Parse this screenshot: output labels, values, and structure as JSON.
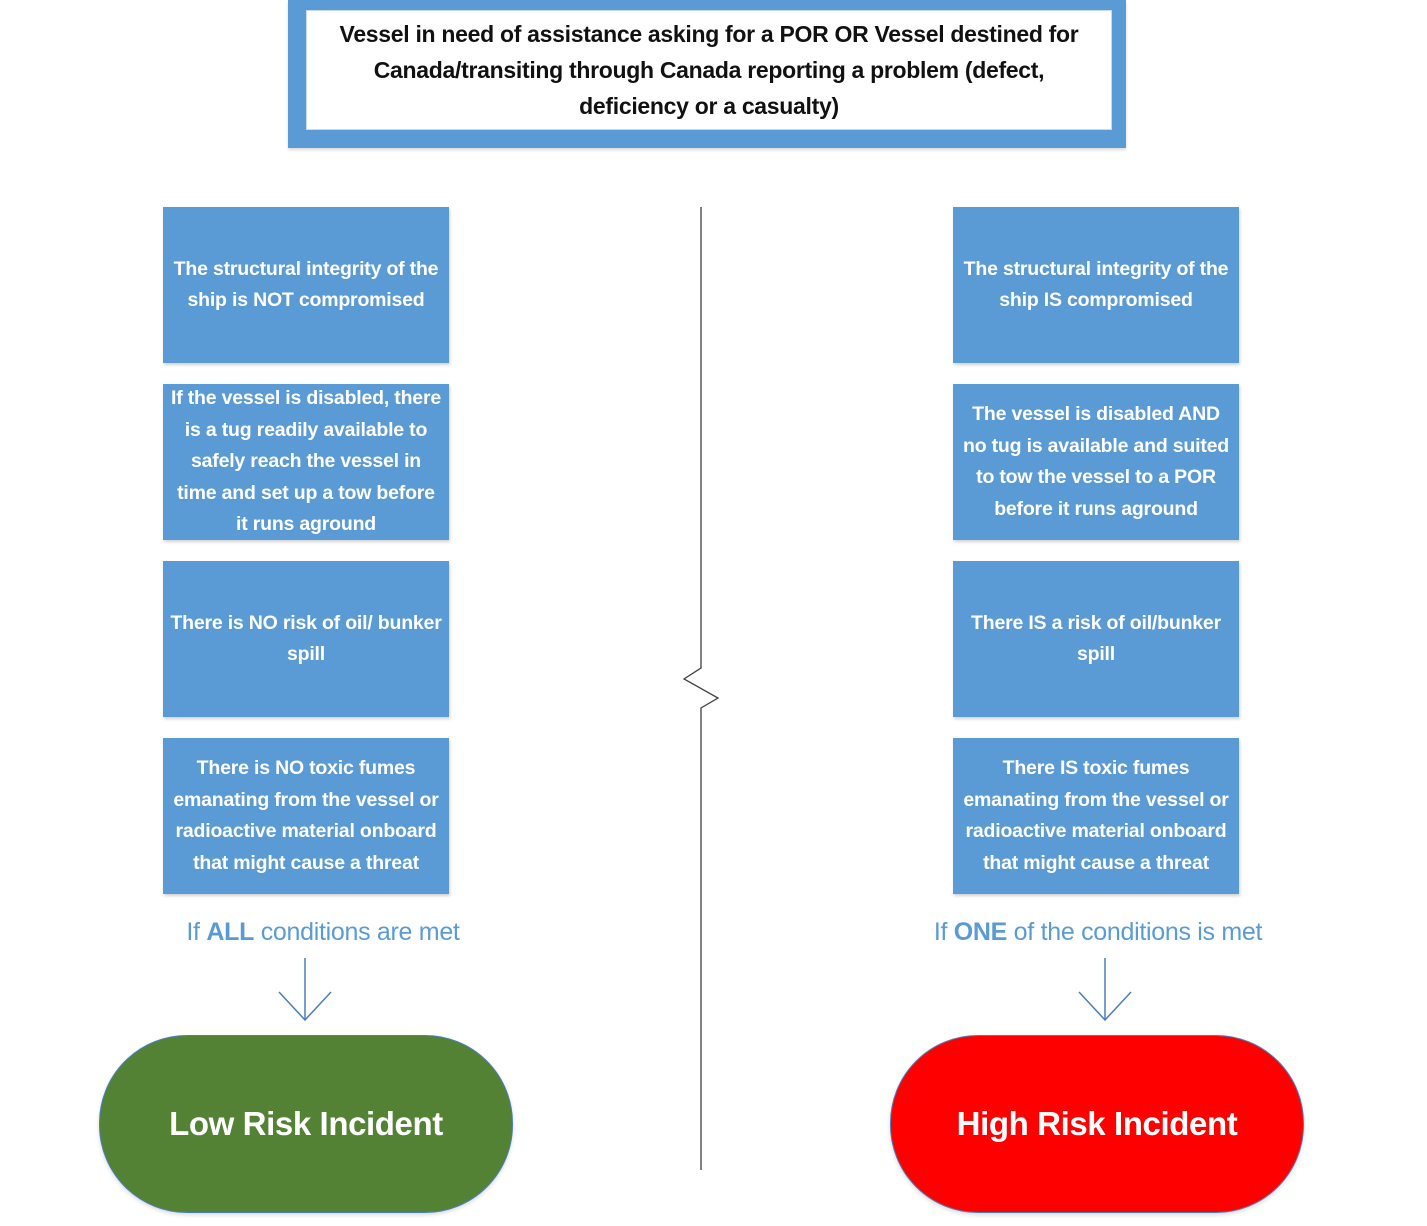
{
  "top_box": {
    "text": "Vessel in need of assistance asking for a POR OR  Vessel destined for Canada/transiting through Canada reporting a problem (defect, deficiency or a casualty)"
  },
  "colors": {
    "box_blue": "#5b9bd5",
    "low_risk_green": "#548235",
    "high_risk_red": "#ff0000",
    "caption_blue": "#5b9bd5"
  },
  "left_column": {
    "conditions": [
      "The structural integrity of the ship is NOT compromised",
      "If the vessel is disabled, there is a tug readily available to safely reach the vessel in time and set up a tow before it runs aground",
      "There is NO risk of oil/ bunker spill",
      "There is NO toxic fumes emanating from the vessel or radioactive material onboard that might cause a threat"
    ],
    "caption": {
      "prefix": "If ",
      "emphasis": "ALL",
      "suffix": " conditions are met"
    },
    "outcome": "Low Risk Incident"
  },
  "right_column": {
    "conditions": [
      "The structural integrity of the ship IS compromised",
      "The vessel is disabled AND no tug is available and suited to tow the vessel to a POR before it runs aground",
      "There IS a risk of oil/bunker spill",
      "There IS toxic fumes emanating from the vessel or radioactive material onboard that might cause a threat"
    ],
    "caption": {
      "prefix": "If ",
      "emphasis": "ONE",
      "suffix": " of the conditions is met"
    },
    "outcome": "High Risk Incident"
  }
}
